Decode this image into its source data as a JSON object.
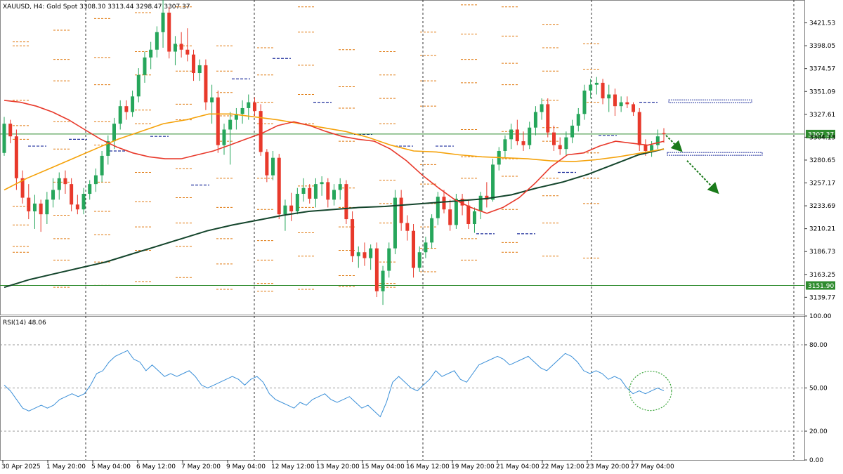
{
  "header": {
    "symbol_line": "XAUUSD, H4:  Gold Spot  3308.30 3313.44 3298.47 3307.37",
    "rsi_line": "RSI(14) 48.06"
  },
  "colors": {
    "bull": "#26a65b",
    "bear": "#e8392b",
    "ma_fast": "#e8392b",
    "ma_mid": "#f5a20a",
    "ma_slow": "#14452c",
    "rsi": "#3a8fd8",
    "hline": "#2e8b2e",
    "pivot_levels": "#e07a10",
    "pivot_blue": "#1f2f9c",
    "arrow": "#1a7a1a",
    "circle": "#3aa53a"
  },
  "chart_data": [
    {
      "type": "candlestick",
      "title": "XAUUSD, H4",
      "ylim": [
        3122,
        3445
      ],
      "y_ticks": [
        "3421.53",
        "3398.05",
        "3374.57",
        "3351.09",
        "3327.61",
        "3304.13",
        "3280.65",
        "3257.17",
        "3233.69",
        "3210.21",
        "3186.73",
        "3163.25",
        "3139.77"
      ],
      "x_ticks": [
        "30 Apr 2025",
        "1 May 20:00",
        "5 May 04:00",
        "6 May 12:00",
        "7 May 20:00",
        "9 May 04:00",
        "12 May 12:00",
        "13 May 20:00",
        "15 May 04:00",
        "16 May 12:00",
        "19 May 20:00",
        "21 May 04:00",
        "22 May 12:00",
        "23 May 20:00",
        "27 May 04:00"
      ],
      "hlines": [
        {
          "value": 3307.37,
          "label": "3307.37"
        },
        {
          "value": 3151.9,
          "label": "3151.90"
        }
      ],
      "ohlc": [
        [
          3288,
          3325,
          3285,
          3318
        ],
        [
          3318,
          3322,
          3298,
          3305
        ],
        [
          3305,
          3312,
          3250,
          3262
        ],
        [
          3262,
          3270,
          3236,
          3242
        ],
        [
          3242,
          3256,
          3220,
          3228
        ],
        [
          3228,
          3245,
          3210,
          3236
        ],
        [
          3236,
          3240,
          3207,
          3225
        ],
        [
          3225,
          3248,
          3215,
          3240
        ],
        [
          3240,
          3262,
          3232,
          3250
        ],
        [
          3250,
          3268,
          3240,
          3262
        ],
        [
          3262,
          3270,
          3246,
          3256
        ],
        [
          3256,
          3262,
          3228,
          3235
        ],
        [
          3235,
          3245,
          3225,
          3230
        ],
        [
          3230,
          3252,
          3225,
          3246
        ],
        [
          3246,
          3260,
          3240,
          3256
        ],
        [
          3256,
          3272,
          3248,
          3265
        ],
        [
          3265,
          3290,
          3258,
          3285
        ],
        [
          3285,
          3306,
          3276,
          3300
        ],
        [
          3300,
          3324,
          3292,
          3318
        ],
        [
          3318,
          3342,
          3312,
          3336
        ],
        [
          3336,
          3342,
          3322,
          3330
        ],
        [
          3330,
          3352,
          3325,
          3346
        ],
        [
          3346,
          3375,
          3340,
          3368
        ],
        [
          3368,
          3392,
          3360,
          3386
        ],
        [
          3386,
          3402,
          3374,
          3394
        ],
        [
          3394,
          3418,
          3386,
          3412
        ],
        [
          3412,
          3445,
          3396,
          3432
        ],
        [
          3432,
          3438,
          3385,
          3392
        ],
        [
          3392,
          3408,
          3378,
          3400
        ],
        [
          3400,
          3412,
          3386,
          3394
        ],
        [
          3394,
          3416,
          3382,
          3389
        ],
        [
          3389,
          3394,
          3362,
          3370
        ],
        [
          3370,
          3384,
          3362,
          3378
        ],
        [
          3378,
          3384,
          3332,
          3340
        ],
        [
          3340,
          3358,
          3318,
          3345
        ],
        [
          3345,
          3352,
          3288,
          3296
        ],
        [
          3296,
          3318,
          3286,
          3312
        ],
        [
          3312,
          3330,
          3276,
          3322
        ],
        [
          3322,
          3334,
          3312,
          3328
        ],
        [
          3328,
          3342,
          3318,
          3334
        ],
        [
          3334,
          3348,
          3322,
          3340
        ],
        [
          3340,
          3345,
          3326,
          3331
        ],
        [
          3331,
          3338,
          3285,
          3289
        ],
        [
          3289,
          3292,
          3258,
          3265
        ],
        [
          3265,
          3290,
          3260,
          3283
        ],
        [
          3283,
          3287,
          3220,
          3225
        ],
        [
          3225,
          3240,
          3208,
          3234
        ],
        [
          3234,
          3247,
          3218,
          3228
        ],
        [
          3228,
          3252,
          3225,
          3246
        ],
        [
          3246,
          3262,
          3238,
          3252
        ],
        [
          3252,
          3256,
          3236,
          3241
        ],
        [
          3241,
          3262,
          3232,
          3256
        ],
        [
          3256,
          3264,
          3244,
          3258
        ],
        [
          3258,
          3262,
          3232,
          3240
        ],
        [
          3240,
          3256,
          3234,
          3250
        ],
        [
          3250,
          3262,
          3240,
          3256
        ],
        [
          3256,
          3260,
          3215,
          3220
        ],
        [
          3220,
          3228,
          3176,
          3182
        ],
        [
          3182,
          3192,
          3170,
          3186
        ],
        [
          3186,
          3196,
          3172,
          3180
        ],
        [
          3180,
          3194,
          3168,
          3190
        ],
        [
          3190,
          3196,
          3140,
          3146
        ],
        [
          3146,
          3172,
          3132,
          3167
        ],
        [
          3167,
          3196,
          3160,
          3190
        ],
        [
          3190,
          3250,
          3184,
          3242
        ],
        [
          3242,
          3250,
          3208,
          3216
        ],
        [
          3216,
          3224,
          3198,
          3208
        ],
        [
          3208,
          3215,
          3160,
          3170
        ],
        [
          3170,
          3192,
          3166,
          3186
        ],
        [
          3186,
          3202,
          3180,
          3196
        ],
        [
          3196,
          3225,
          3190,
          3221
        ],
        [
          3221,
          3248,
          3214,
          3243
        ],
        [
          3243,
          3250,
          3226,
          3230
        ],
        [
          3230,
          3240,
          3208,
          3214
        ],
        [
          3214,
          3246,
          3210,
          3241
        ],
        [
          3241,
          3246,
          3224,
          3234
        ],
        [
          3234,
          3240,
          3210,
          3215
        ],
        [
          3215,
          3232,
          3206,
          3228
        ],
        [
          3228,
          3248,
          3220,
          3244
        ],
        [
          3244,
          3258,
          3232,
          3240
        ],
        [
          3240,
          3282,
          3238,
          3276
        ],
        [
          3276,
          3294,
          3270,
          3290
        ],
        [
          3290,
          3306,
          3282,
          3302
        ],
        [
          3302,
          3318,
          3292,
          3312
        ],
        [
          3312,
          3322,
          3296,
          3300
        ],
        [
          3300,
          3310,
          3290,
          3296
        ],
        [
          3296,
          3320,
          3292,
          3314
        ],
        [
          3314,
          3336,
          3306,
          3330
        ],
        [
          3330,
          3344,
          3322,
          3338
        ],
        [
          3338,
          3344,
          3304,
          3309
        ],
        [
          3309,
          3316,
          3290,
          3296
        ],
        [
          3296,
          3304,
          3286,
          3292
        ],
        [
          3292,
          3310,
          3286,
          3304
        ],
        [
          3304,
          3322,
          3298,
          3316
        ],
        [
          3316,
          3334,
          3310,
          3328
        ],
        [
          3328,
          3358,
          3322,
          3352
        ],
        [
          3352,
          3364,
          3344,
          3358
        ],
        [
          3358,
          3366,
          3348,
          3360
        ],
        [
          3360,
          3364,
          3338,
          3344
        ],
        [
          3344,
          3358,
          3330,
          3348
        ],
        [
          3348,
          3354,
          3326,
          3336
        ],
        [
          3336,
          3346,
          3330,
          3340
        ],
        [
          3340,
          3346,
          3334,
          3338
        ],
        [
          3338,
          3340,
          3326,
          3330
        ],
        [
          3330,
          3334,
          3290,
          3296
        ],
        [
          3296,
          3302,
          3285,
          3290
        ],
        [
          3290,
          3300,
          3284,
          3296
        ],
        [
          3296,
          3312,
          3292,
          3305
        ],
        [
          3308.3,
          3313.44,
          3298.47,
          3307.37
        ]
      ],
      "ma_fast": [
        3342,
        3340,
        3336,
        3330,
        3322,
        3312,
        3302,
        3294,
        3288,
        3284,
        3282,
        3282,
        3286,
        3290,
        3296,
        3302,
        3308,
        3316,
        3320,
        3316,
        3310,
        3305,
        3302,
        3300,
        3292,
        3280,
        3265,
        3252,
        3240,
        3232,
        3226,
        3232,
        3242,
        3257,
        3274,
        3286,
        3288,
        3295,
        3300,
        3298,
        3296,
        3300
      ],
      "ma_mid": [
        3250,
        3262,
        3272,
        3282,
        3292,
        3302,
        3310,
        3318,
        3322,
        3328,
        3328,
        3325,
        3322,
        3318,
        3314,
        3310,
        3304,
        3296,
        3290,
        3289,
        3286,
        3284,
        3283,
        3282,
        3280,
        3279,
        3281,
        3284,
        3288,
        3292
      ],
      "ma_slow": [
        3150,
        3158,
        3164,
        3170,
        3176,
        3184,
        3192,
        3200,
        3208,
        3214,
        3219,
        3224,
        3228,
        3230,
        3232,
        3233,
        3235,
        3237,
        3239,
        3241,
        3245,
        3252,
        3258,
        3266,
        3276,
        3286,
        3292
      ],
      "pivots_orange": [
        [
          3398,
          3402,
          3342,
          3316,
          3302,
          3233,
          3214,
          3192,
          3186,
          3152
        ],
        [
          3414,
          3384,
          3362,
          3320,
          3292,
          3258,
          3224,
          3200,
          3178,
          3150
        ],
        [
          3426,
          3386,
          3358,
          3320,
          3296,
          3258,
          3228,
          3204,
          3176,
          3152
        ],
        [
          3432,
          3392,
          3368,
          3332,
          3318,
          3268,
          3238,
          3212,
          3188,
          3156
        ],
        [
          3438,
          3398,
          3372,
          3338,
          3322,
          3272,
          3242,
          3216,
          3192,
          3160
        ],
        [
          3398,
          3372,
          3350,
          3326,
          3300,
          3262,
          3232,
          3200,
          3174,
          3148
        ],
        [
          3396,
          3368,
          3340,
          3318,
          3262,
          3230,
          3198,
          3178,
          3154,
          3146
        ],
        [
          3438,
          3412,
          3378,
          3348,
          3318,
          3254,
          3232,
          3206,
          3182,
          3148
        ],
        [
          3394,
          3356,
          3334,
          3300,
          3252,
          3232,
          3212,
          3188,
          3162,
          3151
        ],
        [
          3392,
          3368,
          3344,
          3318,
          3260,
          3236,
          3216,
          3176,
          3154,
          3150
        ],
        [
          3412,
          3388,
          3362,
          3336,
          3276,
          3256,
          3236,
          3212,
          3190,
          3166
        ],
        [
          3440,
          3410,
          3384,
          3360,
          3312,
          3284,
          3262,
          3240,
          3200,
          3178
        ],
        [
          3438,
          3408,
          3380,
          3358,
          3310,
          3282,
          3264,
          3230,
          3196,
          3186
        ],
        [
          3420,
          3396,
          3372,
          3342,
          3314,
          3300,
          3262,
          3244,
          3216,
          3182
        ],
        [
          3446,
          3400,
          3374,
          3340,
          3288,
          3262,
          3236,
          3180
        ]
      ],
      "pivots_blue": [
        3295,
        3302,
        3290,
        3305,
        3255,
        3364,
        3385,
        3340,
        3307,
        3295,
        3295,
        3205,
        3205,
        3268,
        3306,
        3340
      ]
    },
    {
      "type": "line",
      "title": "RSI(14) 48.06",
      "ylim": [
        0,
        100
      ],
      "y_ticks": [
        "100.00",
        "80.00",
        "50.00",
        "20.00",
        "0.00"
      ],
      "levels": [
        80,
        50,
        20
      ],
      "values": [
        52,
        48,
        42,
        36,
        34,
        36,
        38,
        36,
        38,
        42,
        44,
        46,
        44,
        46,
        52,
        60,
        62,
        68,
        72,
        74,
        76,
        70,
        68,
        62,
        66,
        62,
        58,
        60,
        58,
        60,
        62,
        58,
        52,
        50,
        52,
        54,
        56,
        58,
        56,
        52,
        56,
        58,
        54,
        46,
        42,
        40,
        38,
        36,
        40,
        38,
        42,
        44,
        46,
        42,
        40,
        42,
        44,
        40,
        36,
        38,
        34,
        30,
        40,
        54,
        58,
        54,
        50,
        48,
        52,
        56,
        62,
        58,
        60,
        62,
        56,
        54,
        60,
        66,
        68,
        70,
        72,
        70,
        66,
        68,
        70,
        72,
        68,
        64,
        62,
        66,
        70,
        74,
        72,
        68,
        62,
        60,
        62,
        60,
        56,
        58,
        56,
        50,
        46,
        48,
        46,
        48,
        50,
        48
      ]
    }
  ],
  "annotations": {
    "ellipse_center_value": 48,
    "trend_arrow": "down-right"
  }
}
